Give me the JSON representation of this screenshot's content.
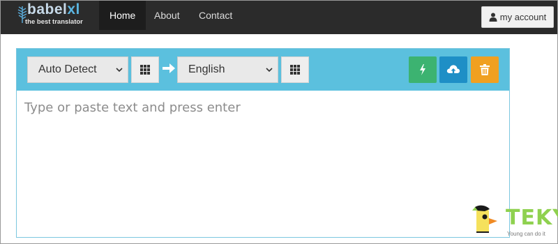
{
  "brand": {
    "name_main": "babel",
    "name_accent": "xl",
    "tagline": "the best translator",
    "leaf_icon": "leaf-logo-icon"
  },
  "nav": {
    "items": [
      {
        "label": "Home",
        "active": true
      },
      {
        "label": "About",
        "active": false
      },
      {
        "label": "Contact",
        "active": false
      }
    ],
    "account_label": "my account",
    "account_icon": "user-icon"
  },
  "translator": {
    "source_language": "Auto Detect",
    "target_language": "English",
    "source_options": [
      "Auto Detect"
    ],
    "target_options": [
      "English"
    ],
    "input_placeholder": "Type or paste text and press enter",
    "input_value": "",
    "buttons": {
      "source_grid_icon": "grid-icon",
      "target_grid_icon": "grid-icon",
      "swap_arrow_icon": "arrow-right-icon",
      "translate_icon": "lightning-icon",
      "upload_icon": "cloud-upload-icon",
      "clear_icon": "trash-icon"
    },
    "colors": {
      "toolbar": "#5bc0de",
      "translate": "#3cb371",
      "upload": "#1e8fc6",
      "clear": "#f0a020"
    }
  },
  "watermark": {
    "text": "TEKY",
    "subtext": "Young can do it"
  }
}
